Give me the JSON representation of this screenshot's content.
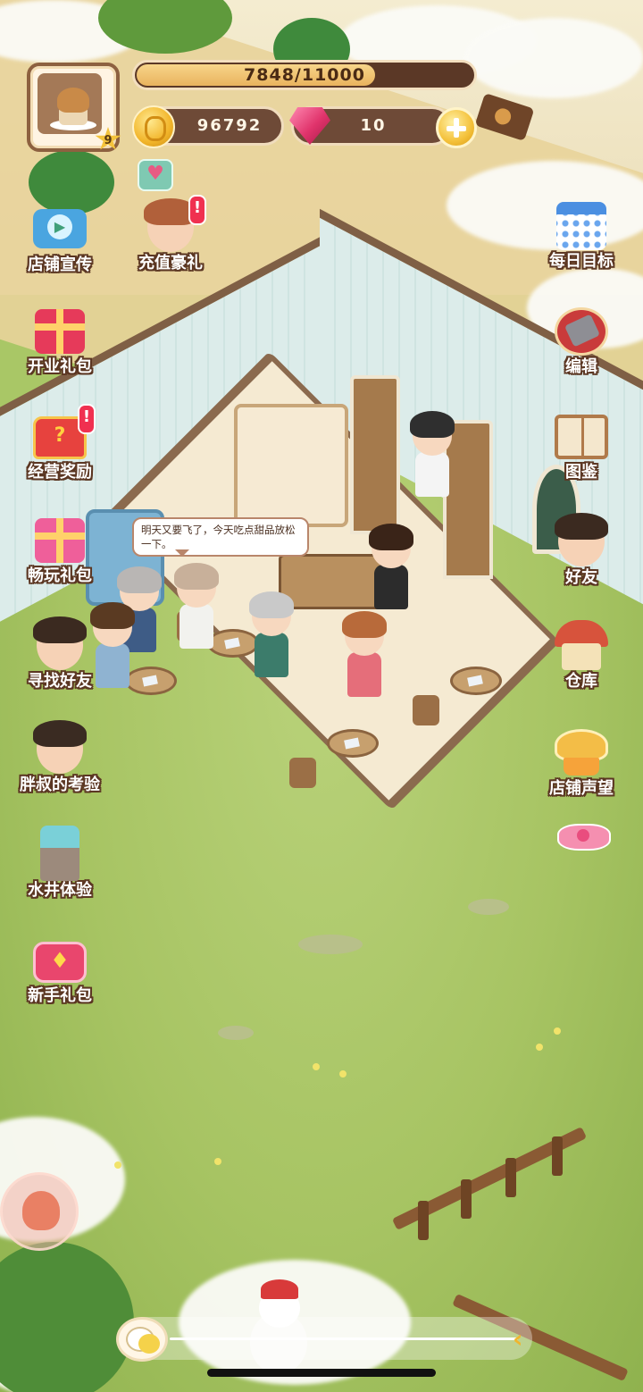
{
  "player": {
    "level": "9",
    "avatar_icon": "muffin-icon",
    "xp": {
      "text": "7848/11000",
      "current": 7848,
      "max": 11000
    }
  },
  "resources": {
    "coins": "96792",
    "gems": "10"
  },
  "speech_bubble": "明天又要飞了，今天吃点甜品放松一下。",
  "left_menu": [
    {
      "label": "店铺宣传",
      "icon": "camera-icon"
    },
    {
      "label": "开业礼包",
      "icon": "gift-box-icon"
    },
    {
      "label": "经营奖励",
      "icon": "treasure-chest-icon"
    },
    {
      "label": "畅玩礼包",
      "icon": "gift-icon"
    },
    {
      "label": "寻找好友",
      "icon": "find-friends-icon"
    },
    {
      "label": "胖叔的考验",
      "icon": "uncle-face-icon"
    },
    {
      "label": "水井体验",
      "icon": "well-icon"
    },
    {
      "label": "新手礼包",
      "icon": "gem-bag-icon"
    }
  ],
  "top_promo": {
    "label": "充值豪礼",
    "icon": "girl-face-icon"
  },
  "right_menu": [
    {
      "label": "每日目标",
      "icon": "calendar-icon"
    },
    {
      "label": "编辑",
      "icon": "tools-icon"
    },
    {
      "label": "图鉴",
      "icon": "book-icon"
    },
    {
      "label": "好友",
      "icon": "friends-icon"
    },
    {
      "label": "仓库",
      "icon": "warehouse-icon"
    },
    {
      "label": "店铺声望",
      "icon": "muffin-icon"
    }
  ],
  "colors": {
    "label_text": "#ffffff",
    "label_outline": "#5b3622",
    "xp_fill": "#e9b35e",
    "gem": "#e0336b",
    "coin": "#f2b52a"
  }
}
